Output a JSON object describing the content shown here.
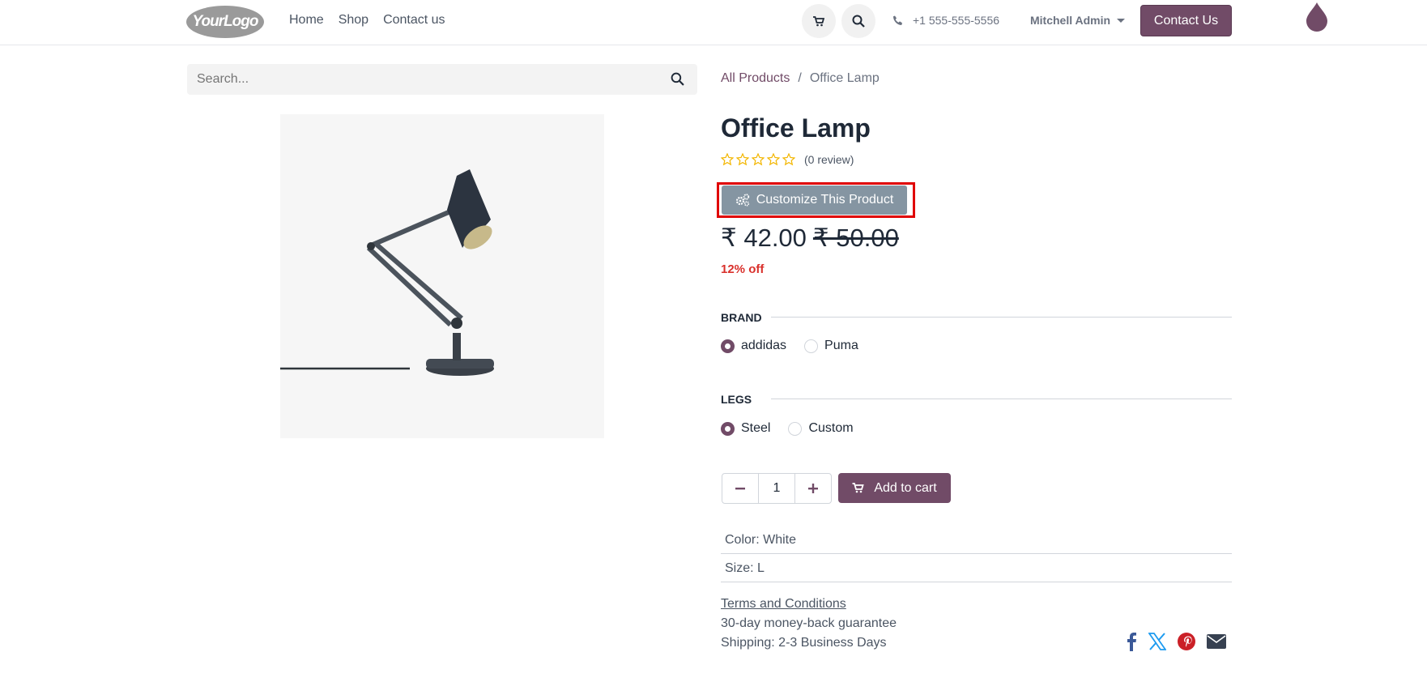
{
  "header": {
    "logo_text": "YourLogo",
    "nav": [
      "Home",
      "Shop",
      "Contact us"
    ],
    "phone": "+1 555-555-5556",
    "user": "Mitchell Admin",
    "contact_label": "Contact Us"
  },
  "search": {
    "placeholder": "Search..."
  },
  "breadcrumb": {
    "parent": "All Products",
    "separator": "/",
    "current": "Office Lamp"
  },
  "product": {
    "name": "Office Lamp",
    "rating_stars": 0,
    "review_text": "(0 review)",
    "customize_label": "Customize This Product",
    "price": "₹ 42.00",
    "old_price": "₹ 50.00",
    "discount": "12% off",
    "attributes": [
      {
        "name": "BRAND",
        "options": [
          "addidas",
          "Puma"
        ],
        "selected": "addidas"
      },
      {
        "name": "LEGS",
        "options": [
          "Steel",
          "Custom"
        ],
        "selected": "Steel"
      }
    ],
    "quantity": "1",
    "add_to_cart_label": "Add to cart",
    "specs": [
      "Color: White",
      "Size: L"
    ],
    "terms_label": "Terms and Conditions",
    "guarantee": "30-day money-back guarantee",
    "shipping": "Shipping: 2-3 Business Days"
  },
  "icons": [
    "cart-icon",
    "search-icon",
    "phone-icon",
    "drop-icon",
    "gears-icon",
    "minus-icon",
    "plus-icon",
    "facebook-icon",
    "x-icon",
    "pinterest-icon",
    "envelope-icon"
  ],
  "colors": {
    "primary": "#714b67",
    "customize_button": "#8595a2",
    "discount": "#d9302b",
    "highlight": "#e00000",
    "stars": "#f3b600"
  }
}
